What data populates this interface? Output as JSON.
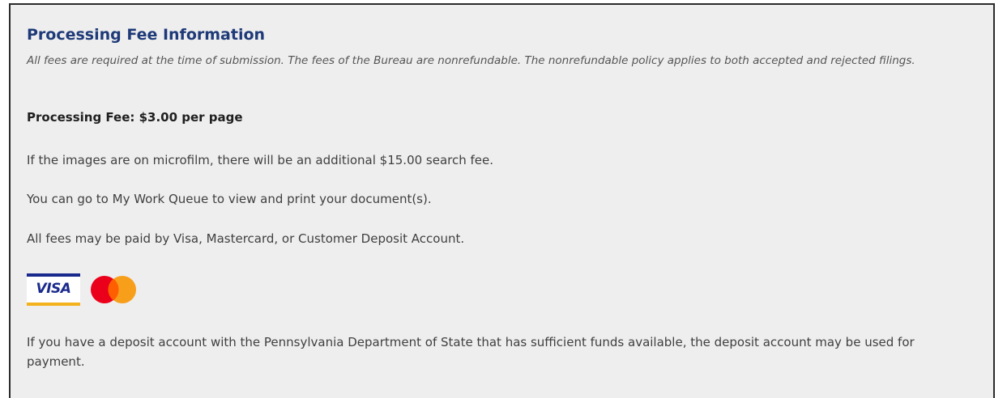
{
  "section": {
    "title": "Processing Fee Information",
    "intro": "All fees are required at the time of submission. The fees of the Bureau are nonrefundable. The nonrefundable policy applies to both accepted and rejected filings.",
    "fee_label": "Processing Fee: $3.00 per page",
    "paragraphs": [
      "If the images are on microfilm, there will be an additional $15.00 search fee.",
      "You can go to My Work Queue to view and print your document(s).",
      "All fees may be paid by Visa, Mastercard, or Customer Deposit Account.",
      "If you have a deposit account with the Pennsylvania Department of State that has sufficient funds available, the deposit account may be used for payment."
    ]
  },
  "payment_icons": {
    "visa": {
      "icon": "visa-icon",
      "text": "VISA",
      "colors": {
        "primary": "#1a2a8c",
        "accent": "#f2b21c"
      }
    },
    "mastercard": {
      "icon": "mastercard-icon",
      "colors": {
        "left": "#eb001b",
        "right": "#f79e1b",
        "overlap": "#ff5f00"
      }
    }
  },
  "colors": {
    "title": "#1e3a78",
    "panel_background": "#eeeeee",
    "border": "#2b2b2b"
  }
}
